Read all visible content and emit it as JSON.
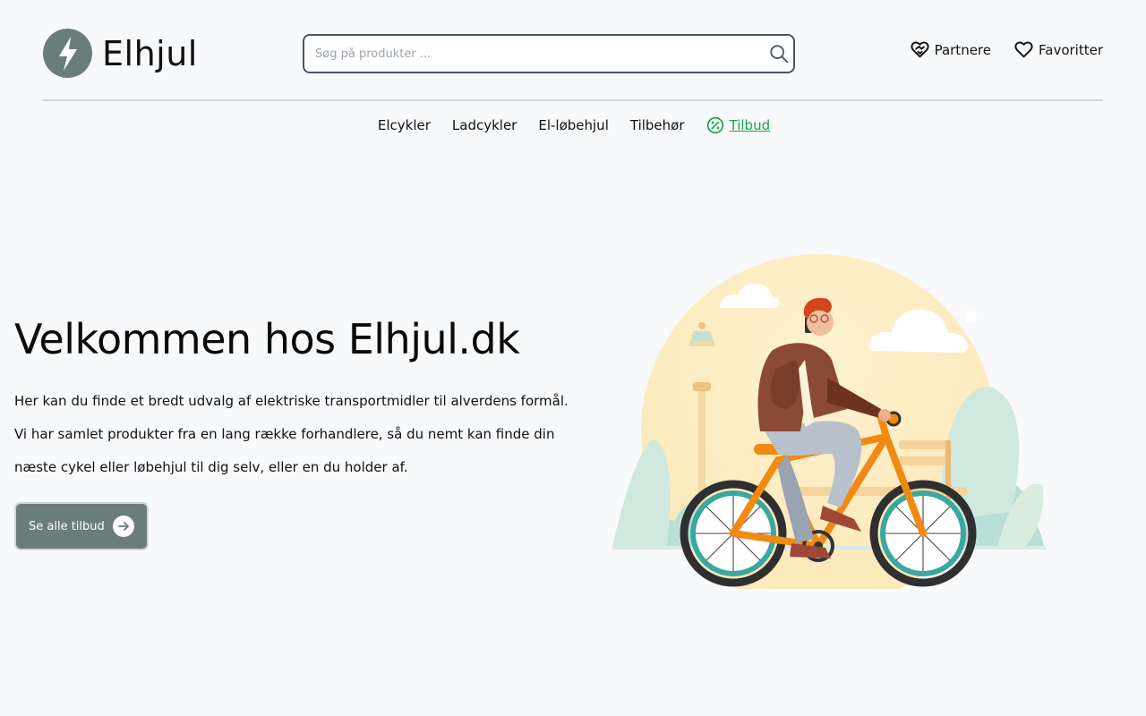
{
  "brand": {
    "name": "Elhjul",
    "color": "#6b7d7a"
  },
  "search": {
    "placeholder": "Søg på produkter ...",
    "value": ""
  },
  "header_links": [
    {
      "label": "Partnere",
      "icon": "partner-heart-icon"
    },
    {
      "label": "Favoritter",
      "icon": "heart-icon"
    }
  ],
  "nav": [
    {
      "label": "Elcykler"
    },
    {
      "label": "Ladcykler"
    },
    {
      "label": "El-løbehjul"
    },
    {
      "label": "Tilbehør"
    },
    {
      "label": "Tilbud",
      "icon": "percent-badge-icon",
      "color": "#16a34a"
    }
  ],
  "hero": {
    "title": "Velkommen hos Elhjul.dk",
    "text": "Her kan du finde et bredt udvalg af elektriske transportmidler til alverdens formål. Vi har samlet produkter fra en lang række forhandlere, så du nemt kan finde din næste cykel eller løbehjul til dig selv, eller en du holder af.",
    "cta_label": "Se alle tilbud",
    "cta_icon": "arrow-right-icon",
    "illustration": "person-riding-bicycle-illustration"
  }
}
